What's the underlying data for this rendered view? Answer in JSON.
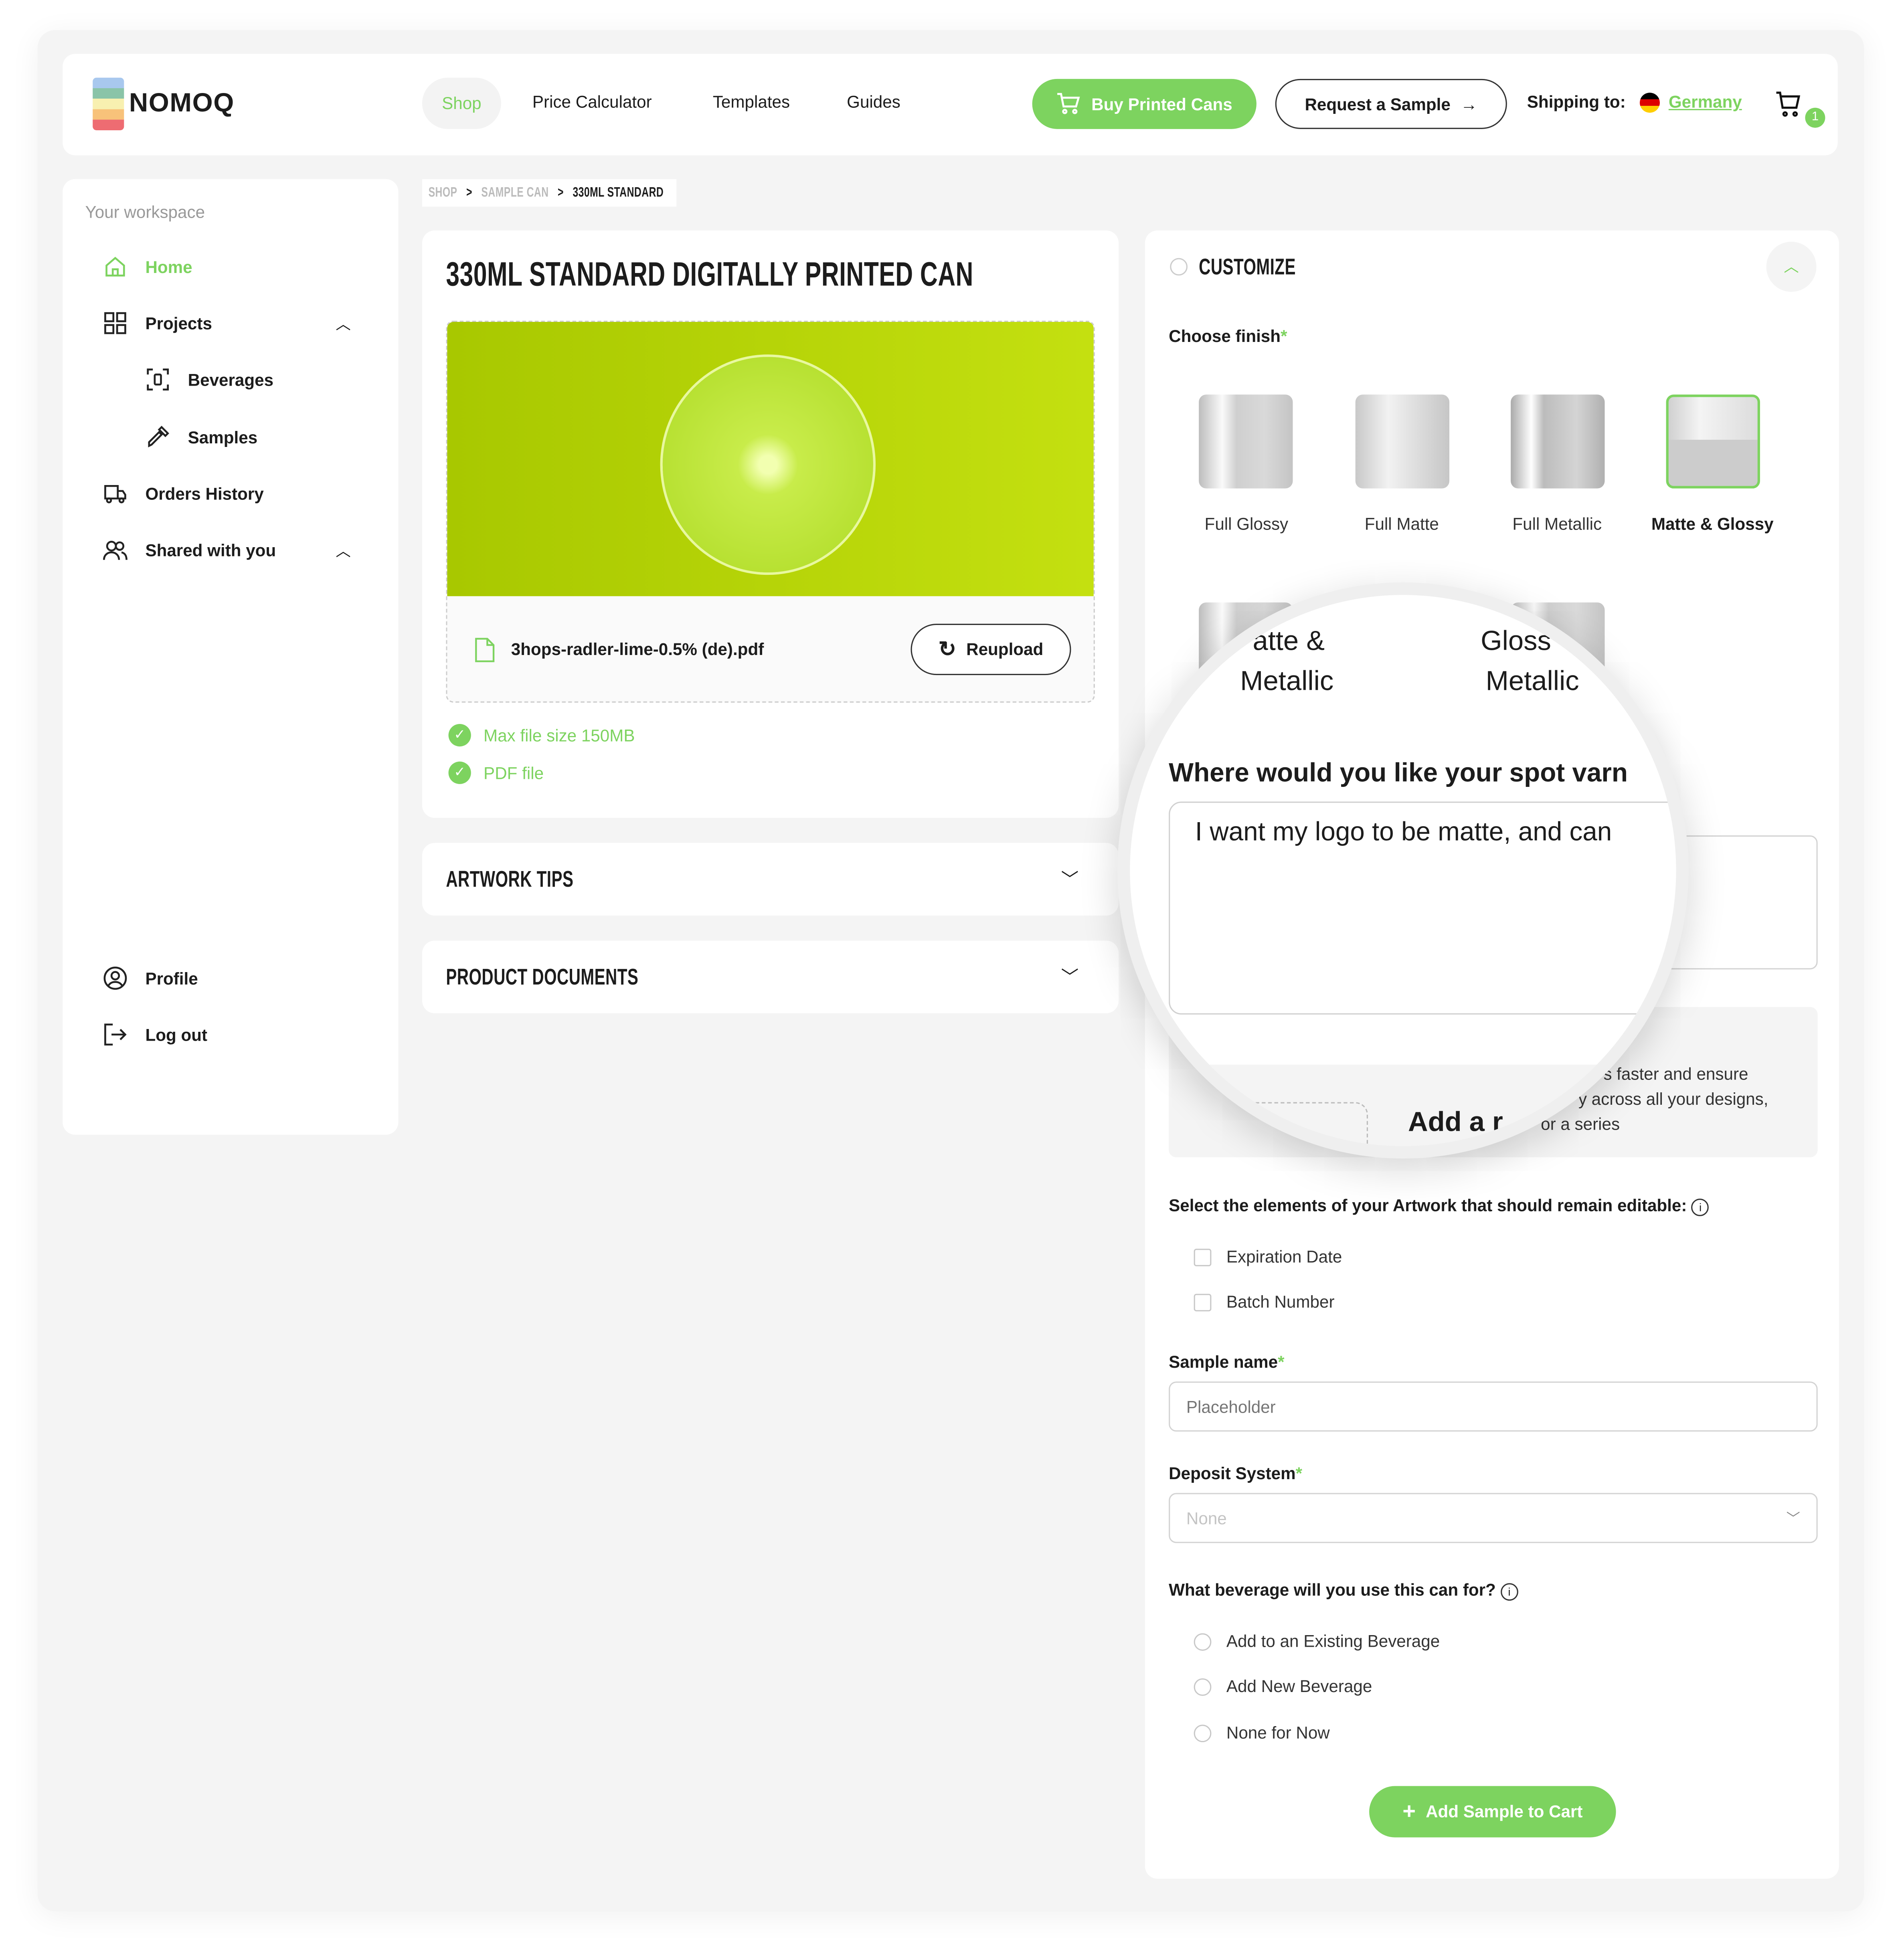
{
  "header": {
    "logo_text": "NOMOQ",
    "nav": [
      {
        "label": "Shop",
        "active": true
      },
      {
        "label": "Price Calculator"
      },
      {
        "label": "Templates"
      },
      {
        "label": "Guides"
      }
    ],
    "buy_button": "Buy Printed Cans",
    "sample_button": "Request a Sample",
    "shipping_label": "Shipping to:",
    "shipping_country": "Germany",
    "cart_count": "1",
    "accent": "#7dd35f"
  },
  "sidebar": {
    "section_label": "Your workspace",
    "items": [
      {
        "label": "Home",
        "icon": "home-icon",
        "active": true
      },
      {
        "label": "Projects",
        "icon": "grid-icon"
      },
      {
        "label": "Beverages",
        "icon": "scan-icon"
      },
      {
        "label": "Samples",
        "icon": "pipette-icon"
      },
      {
        "label": "Orders History",
        "icon": "truck-icon"
      },
      {
        "label": "Shared with you",
        "icon": "users-icon"
      }
    ],
    "profile": "Profile",
    "logout": "Log out"
  },
  "breadcrumb": [
    "SHOP",
    "SAMPLE CAN",
    "330ML STANDARD"
  ],
  "product": {
    "title": "330ML STANDARD DIGITALLY PRINTED CAN",
    "file_name": "3hops-radler-lime-0.5% (de).pdf",
    "reupload": "Reupload",
    "checks": [
      "Max file size 150MB",
      "PDF file"
    ]
  },
  "accordions": [
    "ARTWORK TIPS",
    "PRODUCT DOCUMENTS"
  ],
  "customize": {
    "title": "CUSTOMIZE",
    "finish_label": "Choose finish",
    "finishes": [
      {
        "label": "Full Glossy"
      },
      {
        "label": "Full Matte"
      },
      {
        "label": "Full Metallic"
      },
      {
        "label": "Matte & Glossy",
        "selected": true
      }
    ],
    "magnifier": {
      "finish_row2": [
        "Matte & Metallic",
        "Glossy Metallic"
      ],
      "finish_row2_visible": [
        "atte &",
        "Metallic",
        "Gloss",
        "Metallic"
      ],
      "question": "Where would you like your spot varn",
      "textarea_value": "I want my logo to be matte, and can",
      "ref_title": "Add a r"
    },
    "ref_text": [
      "s faster and ensure",
      "y across all your designs,",
      "or a series"
    ],
    "editable_label": "Select the elements of your Artwork that should remain editable:",
    "editable_options": [
      "Expiration Date",
      "Batch Number"
    ],
    "sample_name_label": "Sample name",
    "sample_name_placeholder": "Placeholder",
    "deposit_label": "Deposit System",
    "deposit_value": "None",
    "beverage_label": "What beverage will you use this can for?",
    "beverage_options": [
      "Add to an Existing Beverage",
      "Add New Beverage",
      "None for Now"
    ],
    "add_button": "Add Sample to Cart"
  }
}
